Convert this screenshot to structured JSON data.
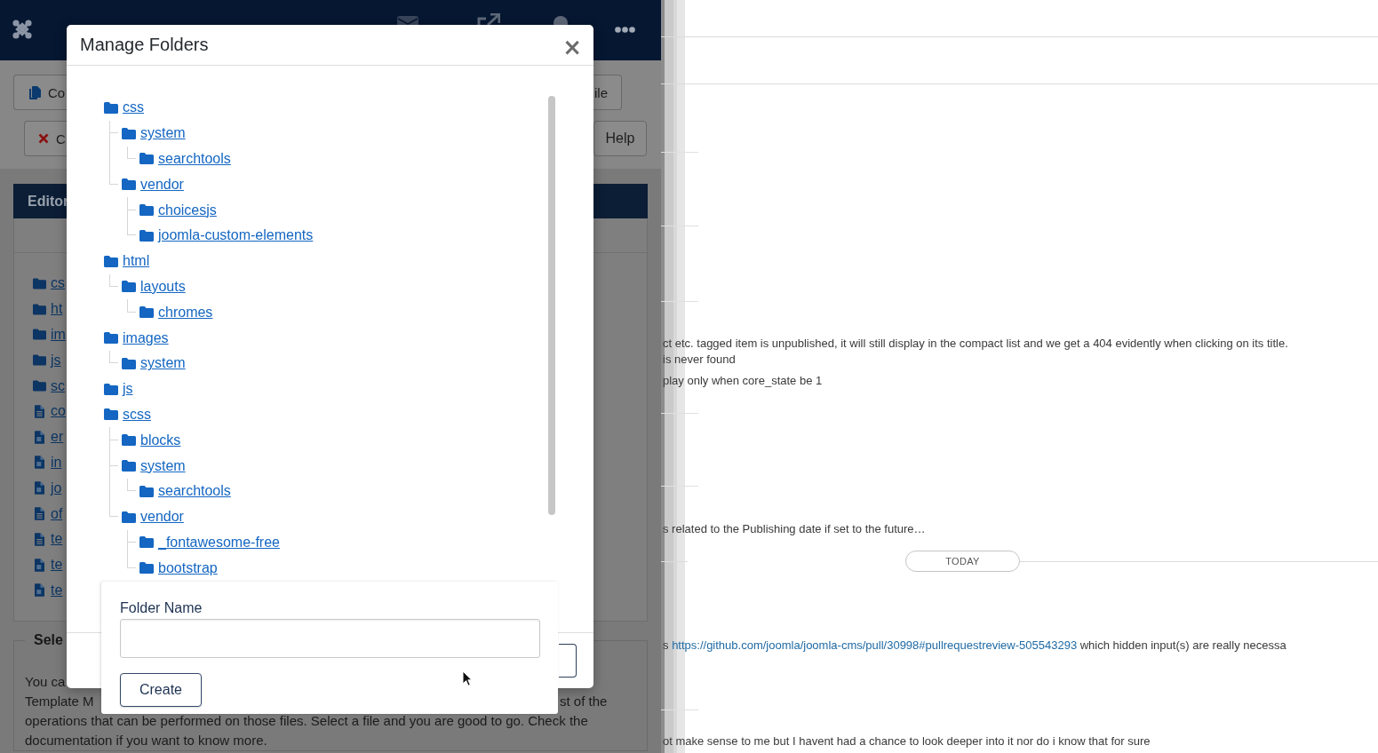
{
  "toolbar": [
    {
      "buttons": [
        {
          "label": "Co"
        },
        {
          "label": "ile"
        }
      ]
    },
    {
      "buttons": [
        {
          "label": "C"
        },
        {
          "label": "Help"
        }
      ]
    }
  ],
  "editor": {
    "title": "Editor",
    "files": [
      {
        "name": "cs",
        "kind": "folder"
      },
      {
        "name": "ht",
        "kind": "folder"
      },
      {
        "name": "im",
        "kind": "folder"
      },
      {
        "name": "js",
        "kind": "folder"
      },
      {
        "name": "sc",
        "kind": "folder"
      },
      {
        "name": "co",
        "kind": "text"
      },
      {
        "name": "er",
        "kind": "code"
      },
      {
        "name": "in",
        "kind": "code"
      },
      {
        "name": "jo",
        "kind": "code"
      },
      {
        "name": "of",
        "kind": "text"
      },
      {
        "name": "te",
        "kind": "text"
      },
      {
        "name": "te",
        "kind": "code"
      },
      {
        "name": "te",
        "kind": "code"
      }
    ]
  },
  "info": {
    "legend": "Sele",
    "lines": [
      [
        "You ca"
      ],
      [
        "Template M",
        "st of the"
      ],
      [
        "operations that can be performed on those files. Select a file and you are good to go. Check the"
      ],
      [
        "documentation if you want to know more."
      ]
    ]
  },
  "modal": {
    "title": "Manage Folders",
    "close": "×",
    "tree": [
      {
        "name": "css",
        "children": [
          {
            "name": "system",
            "children": [
              {
                "name": "searchtools"
              }
            ]
          },
          {
            "name": "vendor",
            "children": [
              {
                "name": "choicesjs"
              },
              {
                "name": "joomla-custom-elements"
              }
            ]
          }
        ]
      },
      {
        "name": "html",
        "children": [
          {
            "name": "layouts",
            "children": [
              {
                "name": "chromes"
              }
            ]
          }
        ]
      },
      {
        "name": "images",
        "children": [
          {
            "name": "system"
          }
        ]
      },
      {
        "name": "js"
      },
      {
        "name": "scss",
        "children": [
          {
            "name": "blocks"
          },
          {
            "name": "system",
            "children": [
              {
                "name": "searchtools"
              }
            ]
          },
          {
            "name": "vendor",
            "children": [
              {
                "name": "_fontawesome-free"
              },
              {
                "name": "bootstrap"
              }
            ]
          }
        ]
      }
    ]
  },
  "folder_form": {
    "label": "Folder Name",
    "button": "Create"
  },
  "chat": {
    "blocks": [
      {
        "kind": "text",
        "lines": [
          "ct etc. tagged item is unpublished, it will still display in the compact list and we get a 404 evidently when clicking on its title.",
          "is never found"
        ]
      },
      {
        "kind": "text",
        "lines": [
          "play only when core_state be 1"
        ]
      },
      {
        "kind": "text",
        "lines": [
          "s related to the Publishing date if set to the future…"
        ]
      },
      {
        "kind": "divider",
        "label": "TODAY"
      },
      {
        "kind": "link",
        "before": "s ",
        "link": "https://github.com/joomla/joomla-cms/pull/30998#pullrequestreview-505543293",
        "after": " which hidden input(s) are really necessa"
      },
      {
        "kind": "text",
        "lines": [
          "ot make sense to me but I havent had a chance to look deeper into it nor do i know that for sure"
        ]
      }
    ]
  }
}
